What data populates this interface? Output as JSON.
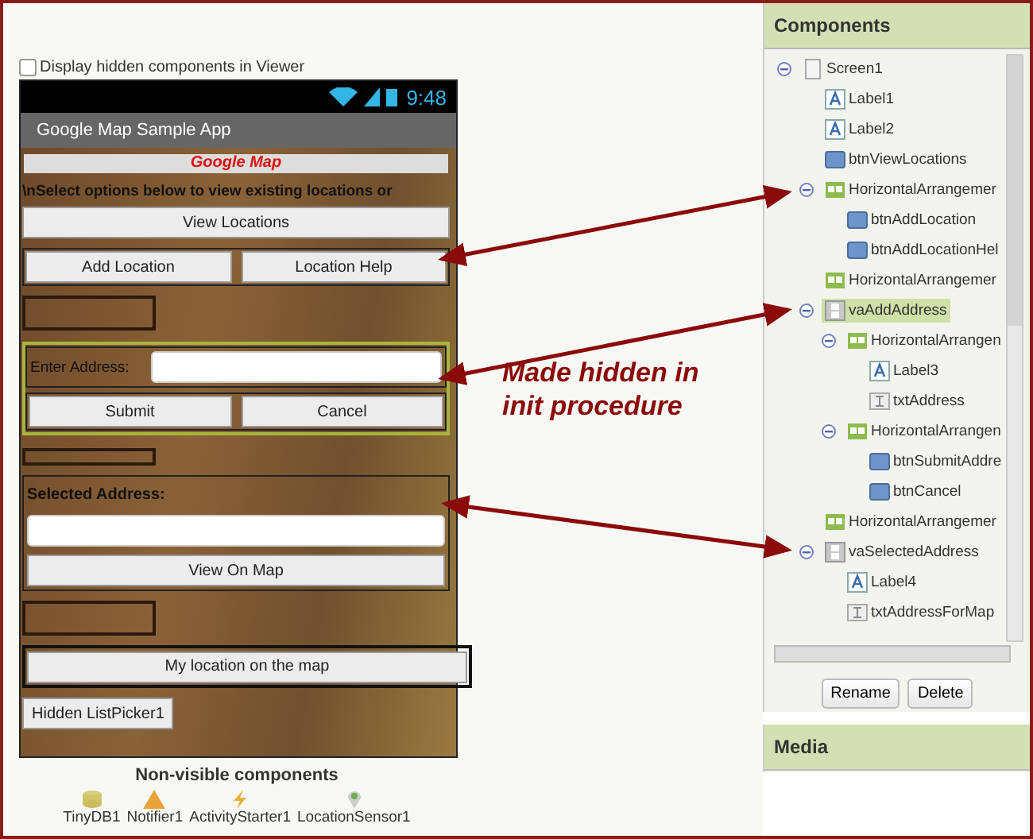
{
  "viewer": {
    "hidden_checkbox": {
      "label": "Display hidden components in Viewer",
      "checked": false
    },
    "phone": {
      "time": "9:48",
      "app_title": "Google Map Sample App",
      "items": [
        {
          "kind": "title_label",
          "text": "Google Map"
        },
        {
          "kind": "label",
          "text": "\\nSelect options below to view existing locations or"
        },
        {
          "kind": "button",
          "text": "View Locations"
        },
        {
          "kind": "button_row",
          "buttons": [
            "Add Location",
            "Location Help"
          ]
        },
        {
          "kind": "empty_box"
        },
        {
          "kind": "address_block",
          "selected": true,
          "label": "Enter Address:",
          "buttons": [
            "Submit",
            "Cancel"
          ]
        },
        {
          "kind": "small_box"
        },
        {
          "kind": "selected_block",
          "label": "Selected Address:",
          "button": "View On Map"
        },
        {
          "kind": "empty_box"
        },
        {
          "kind": "framed_button",
          "text": "My location on the map"
        },
        {
          "kind": "small_button",
          "text": "Hidden ListPicker1"
        }
      ]
    },
    "non_visible": {
      "title": "Non-visible components",
      "items": [
        {
          "kind": "db",
          "name": "TinyDB1"
        },
        {
          "kind": "notifier",
          "name": "Notifier1"
        },
        {
          "kind": "activity",
          "name": "ActivityStarter1"
        },
        {
          "kind": "location",
          "name": "LocationSensor1"
        }
      ]
    }
  },
  "annotation": "Made hidden in init procedure",
  "components": {
    "title": "Components",
    "tree": [
      {
        "kind": "screen",
        "name": "Screen1",
        "selected": false,
        "children": [
          {
            "kind": "label",
            "name": "Label1",
            "selected": false
          },
          {
            "kind": "label",
            "name": "Label2",
            "selected": false
          },
          {
            "kind": "button",
            "name": "btnViewLocations",
            "selected": false
          },
          {
            "kind": "harr",
            "name": "HorizontalArrangemer",
            "selected": false,
            "children": [
              {
                "kind": "button",
                "name": "btnAddLocation",
                "selected": false
              },
              {
                "kind": "button",
                "name": "btnAddLocationHel",
                "selected": false
              }
            ]
          },
          {
            "kind": "harr",
            "name": "HorizontalArrangemer",
            "selected": false
          },
          {
            "kind": "varr",
            "name": "vaAddAddress",
            "selected": true,
            "children": [
              {
                "kind": "harr",
                "name": "HorizontalArrangen",
                "selected": false,
                "children": [
                  {
                    "kind": "label",
                    "name": "Label3",
                    "selected": false
                  },
                  {
                    "kind": "textbox",
                    "name": "txtAddress",
                    "selected": false
                  }
                ]
              },
              {
                "kind": "harr",
                "name": "HorizontalArrangen",
                "selected": false,
                "children": [
                  {
                    "kind": "button",
                    "name": "btnSubmitAddre",
                    "selected": false
                  },
                  {
                    "kind": "button",
                    "name": "btnCancel",
                    "selected": false
                  }
                ]
              }
            ]
          },
          {
            "kind": "harr",
            "name": "HorizontalArrangemer",
            "selected": false
          },
          {
            "kind": "varr",
            "name": "vaSelectedAddress",
            "selected": false,
            "children": [
              {
                "kind": "label",
                "name": "Label4",
                "selected": false
              },
              {
                "kind": "textbox",
                "name": "txtAddressForMap",
                "selected": false
              }
            ]
          }
        ]
      }
    ],
    "buttons": [
      "Rename",
      "Delete"
    ]
  },
  "media": {
    "title": "Media"
  }
}
